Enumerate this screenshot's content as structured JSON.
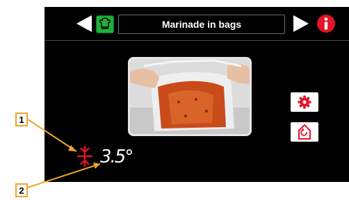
{
  "header": {
    "title": "Marinade in bags",
    "icons": {
      "nav_left": "triangle-left-icon",
      "recipe": "chef-hat-icon",
      "nav_right": "triangle-right-icon",
      "info": "info-icon"
    }
  },
  "image": {
    "subject": "hands-opening-bag-of-marinated-meat"
  },
  "side_buttons": {
    "settings_icon": "gear-icon",
    "home_icon": "home-cycle-icon"
  },
  "temperature": {
    "icon": "snowflake-temp-icon",
    "value": "3.5°"
  },
  "callouts": [
    "1",
    "2"
  ],
  "colors": {
    "screen_bg": "#000000",
    "accent_red": "#e0152a",
    "recipe_green": "#1fb03a",
    "callout_orange": "#f0a52a"
  }
}
